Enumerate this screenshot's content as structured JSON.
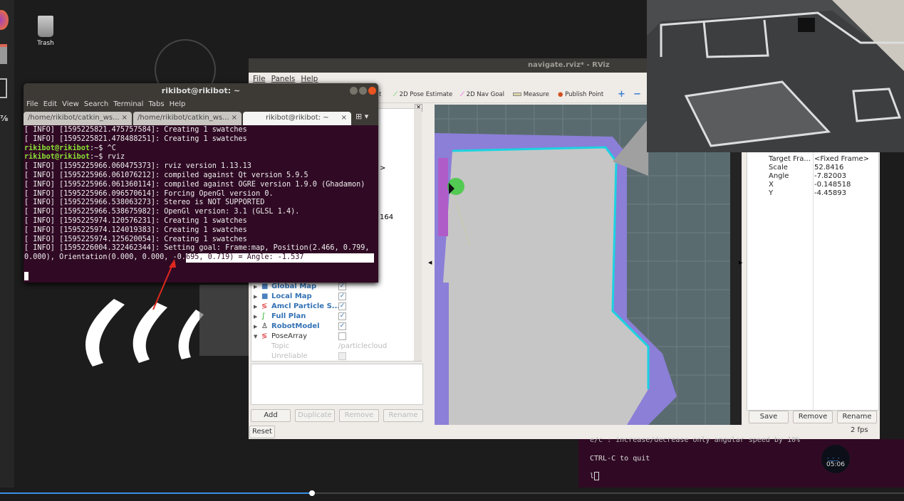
{
  "desktop": {
    "trash_label": "Trash"
  },
  "terminal": {
    "title": "rikibot@rikibot: ~",
    "menu": [
      "File",
      "Edit",
      "View",
      "Search",
      "Terminal",
      "Tabs",
      "Help"
    ],
    "tabs": [
      {
        "label": "/home/rikibot/catkin_ws...",
        "close": "×"
      },
      {
        "label": "/home/rikibot/catkin_ws...",
        "close": "×"
      },
      {
        "label": "rikibot@rikibot: ~",
        "close": "×"
      }
    ],
    "lines": [
      "[ INFO] [1595225821.475757584]: Creating 1 swatches",
      "[ INFO] [1595225821.478488251]: Creating 1 swatches"
    ],
    "prompt": "rikibot@rikibot",
    "prompt_suffix": ":~$ ",
    "cmd1": "^C",
    "cmd2": "rviz",
    "log": [
      "[ INFO] [1595225966.060475373]: rviz version 1.13.13",
      "[ INFO] [1595225966.061076212]: compiled against Qt version 5.9.5",
      "[ INFO] [1595225966.061360114]: compiled against OGRE version 1.9.0 (Ghadamon)",
      "[ INFO] [1595225966.096570614]: Forcing OpenGl version 0.",
      "[ INFO] [1595225966.538063273]: Stereo is NOT SUPPORTED",
      "[ INFO] [1595225966.538675982]: OpenGl version: 3.1 (GLSL 1.4).",
      "[ INFO] [1595225974.120576231]: Creating 1 swatches",
      "[ INFO] [1595225974.124019383]: Creating 1 swatches",
      "[ INFO] [1595225974.125620054]: Creating 1 swatches",
      "[ INFO] [1595226004.322462344]: Setting goal: Frame:map, Position(2.466, 0.799,"
    ],
    "goal_line_a": "0.000), Orientation(0.000, 0.000, -0.",
    "goal_line_b": "695, 0.719) = Angle: -1.537"
  },
  "rviz": {
    "title": "navigate.rviz* - RViz",
    "menu": [
      "File",
      "Panels",
      "Help"
    ],
    "toolbar": {
      "partial": "t",
      "pose_estimate": "2D Pose Estimate",
      "nav_goal": "2D Nav Goal",
      "measure": "Measure",
      "publish_point": "Publish Point"
    },
    "displays_fragments": [
      ">",
      "164"
    ],
    "displays": [
      {
        "label": "Global Map",
        "checked": true,
        "icon": "folder-icon"
      },
      {
        "label": "Local Map",
        "checked": true,
        "icon": "folder-icon"
      },
      {
        "label": "Amcl Particle S...",
        "checked": true,
        "icon": "pose-array-icon"
      },
      {
        "label": "Full Plan",
        "checked": true,
        "icon": "path-icon"
      },
      {
        "label": "RobotModel",
        "checked": true,
        "icon": "robot-model-icon"
      },
      {
        "label": "PoseArray",
        "checked": false,
        "icon": "pose-array-icon"
      }
    ],
    "posearray_props": [
      {
        "label": "Topic",
        "value": "/particlecloud"
      },
      {
        "label": "Unreliable",
        "value": ""
      }
    ],
    "buttons": {
      "add": "Add",
      "duplicate": "Duplicate",
      "remove": "Remove",
      "rename": "Rename",
      "reset": "Reset"
    },
    "view_props": [
      {
        "label": "Target Fra...",
        "value": "<Fixed Frame>"
      },
      {
        "label": "Scale",
        "value": "52.8416"
      },
      {
        "label": "Angle",
        "value": "-7.82003"
      },
      {
        "label": "X",
        "value": "-0.148518"
      },
      {
        "label": "Y",
        "value": "-4.45893"
      }
    ],
    "view_buttons": {
      "save": "Save",
      "remove": "Remove",
      "rename": "Rename"
    },
    "fps": "2 fps"
  },
  "bottom_terminal": {
    "lines": [
      "e/c : increase/decrease only angular speed by 10%",
      "CTRL-C to quit",
      "l"
    ]
  },
  "video": {
    "timer": "05:06",
    "progress": 0.345
  },
  "colors": {
    "terminal_bg": "#300a24",
    "prompt": "#8ae234",
    "rviz_link": "#3472b4",
    "arrow": "#e0281e"
  }
}
